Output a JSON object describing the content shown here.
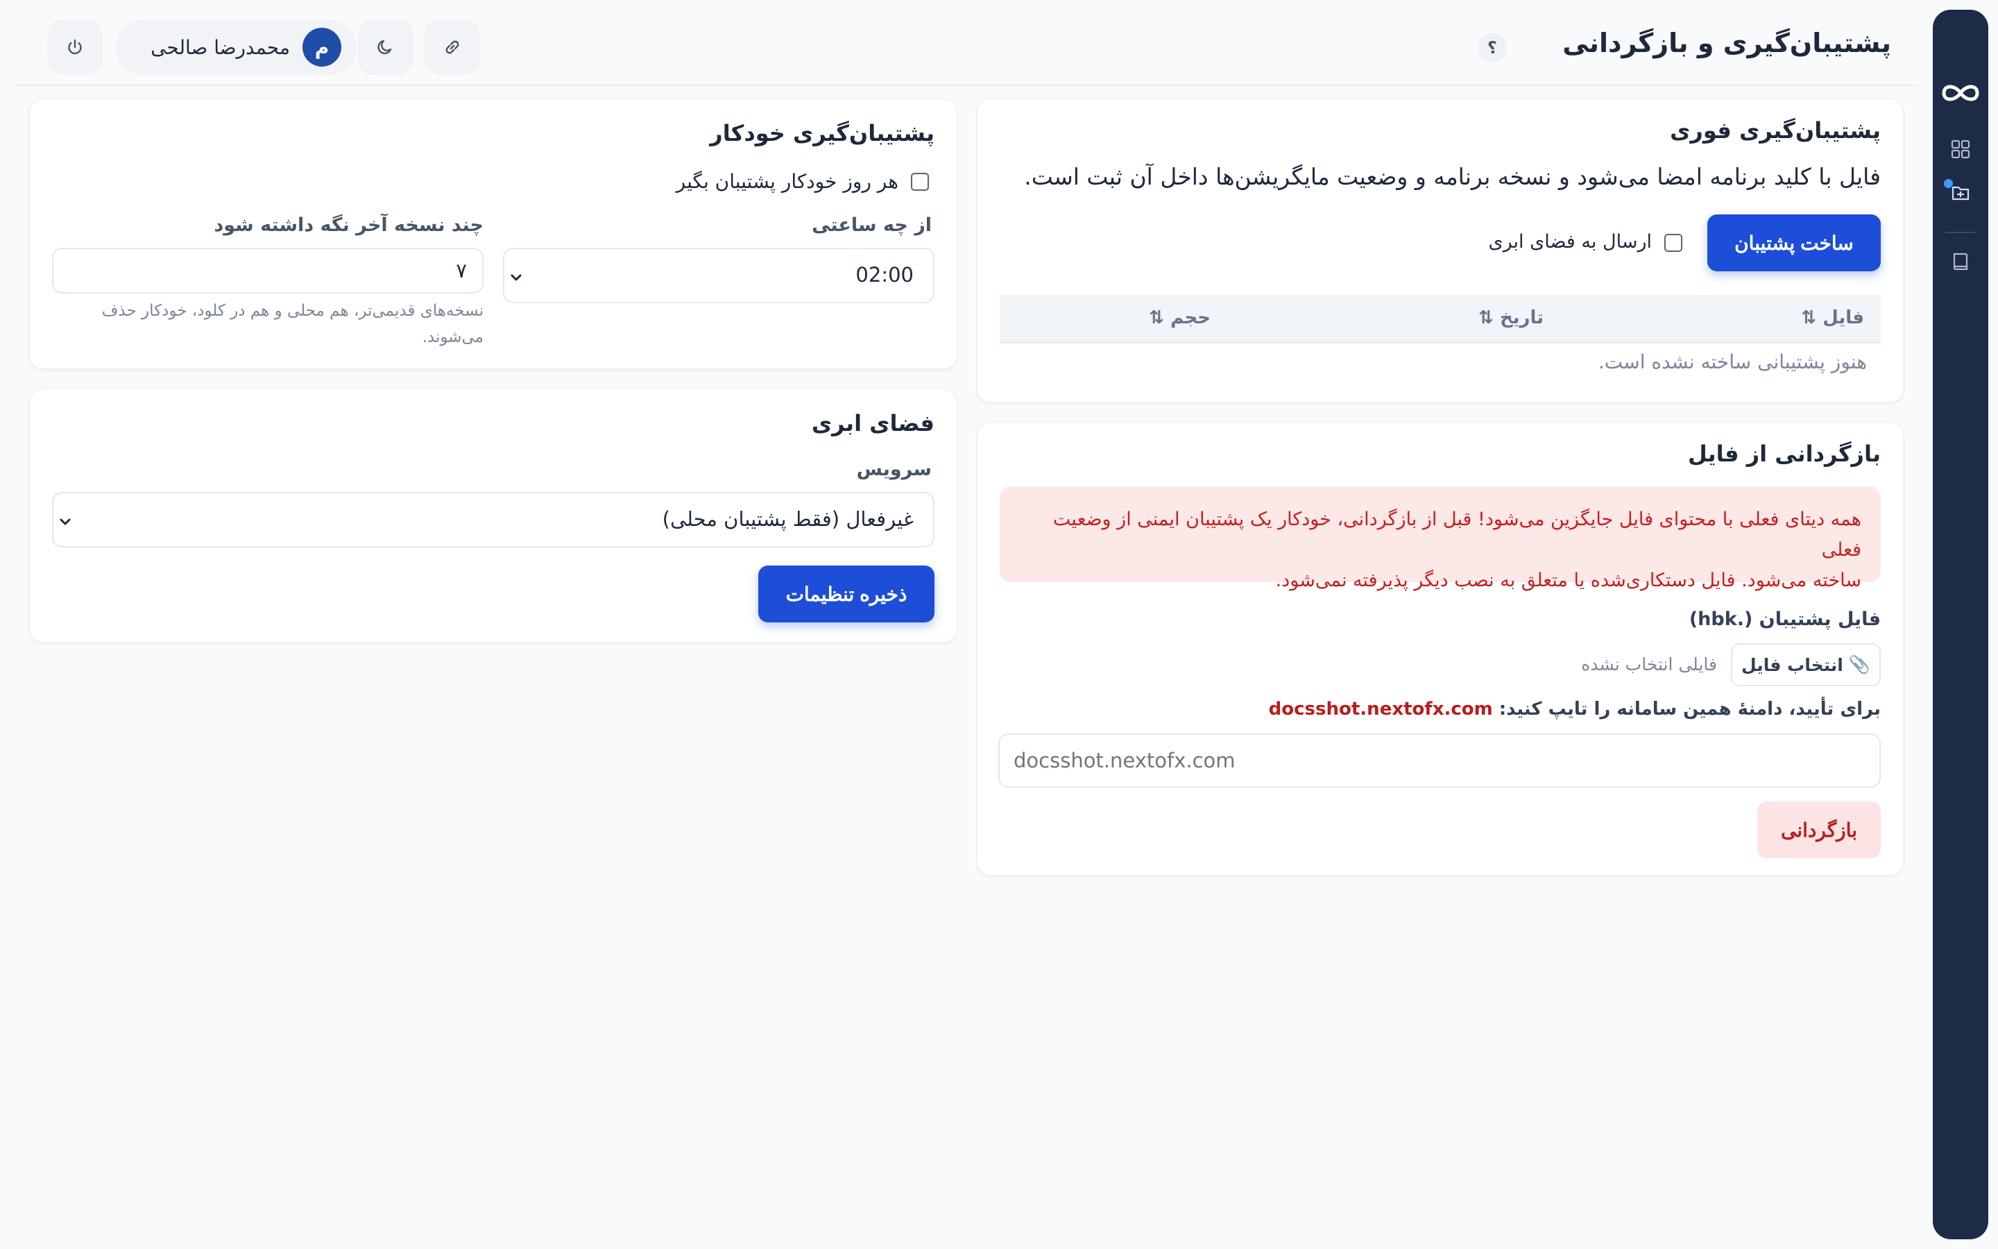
{
  "header": {
    "title": "پشتیبان‌گیری و بازگردانی",
    "help_label": "؟",
    "user": {
      "name": "محمدرضا صالحی",
      "initial": "م"
    }
  },
  "instant_backup": {
    "title": "پشتیبان‌گیری فوری",
    "description": "فایل با کلید برنامه امضا می‌شود و نسخه برنامه و وضعیت مایگریشن‌ها داخل آن ثبت است.",
    "create_button": "ساخت پشتیبان",
    "cloud_checkbox_label": "ارسال به فضای ابری",
    "cloud_checked": false,
    "table": {
      "columns": [
        "فایل ⇅",
        "تاریخ ⇅",
        "حجم ⇅"
      ],
      "empty_text": "هنوز پشتیبانی ساخته نشده است."
    }
  },
  "restore": {
    "title": "بازگردانی از فایل",
    "warning_line1": "همه دیتای فعلی با محتوای فایل جایگزین می‌شود! قبل از بازگردانی، خودکار یک پشتیبان ایمنی از وضعیت فعلی",
    "warning_line2": "ساخته می‌شود. فایل دستکاری‌شده یا متعلق به نصب دیگر پذیرفته نمی‌شود.",
    "file_label": "فایل پشتیبان (.hbk)",
    "choose_file_button": "انتخاب فایل",
    "no_file_text": "فایلی انتخاب نشده",
    "confirm_label": "برای تأیید، دامنهٔ همین سامانه را تایپ کنید:",
    "domain": "docsshot.nextofx.com",
    "confirm_placeholder": "docsshot.nextofx.com",
    "restore_button": "بازگردانی"
  },
  "auto_backup": {
    "title": "پشتیبان‌گیری خودکار",
    "daily_checkbox_label": "هر روز خودکار پشتیبان بگیر",
    "daily_checked": false,
    "time_label": "از چه ساعتی",
    "time_value": "02:00",
    "keep_label": "چند نسخه آخر نگه داشته شود",
    "keep_value": "۷",
    "keep_hint_line1": "نسخه‌های قدیمی‌تر، هم محلی و هم در کلود، خودکار حذف",
    "keep_hint_line2": "می‌شوند."
  },
  "cloud": {
    "title": "فضای ابری",
    "service_label": "سرویس",
    "service_value": "غیرفعال (فقط پشتیبان محلی)",
    "save_button": "ذخیره تنظیمات"
  },
  "colors": {
    "primary": "#1d4ed8",
    "danger_text": "#c81e1e",
    "danger_bg": "#fde8e8",
    "rail": "#1e2b47"
  },
  "icons": {
    "rail": [
      "infinity-logo-icon",
      "dashboard-grid-icon",
      "backup-icon",
      "book-icon"
    ],
    "header": [
      "link-icon",
      "moon-icon",
      "power-icon"
    ],
    "file": "paperclip-icon"
  }
}
